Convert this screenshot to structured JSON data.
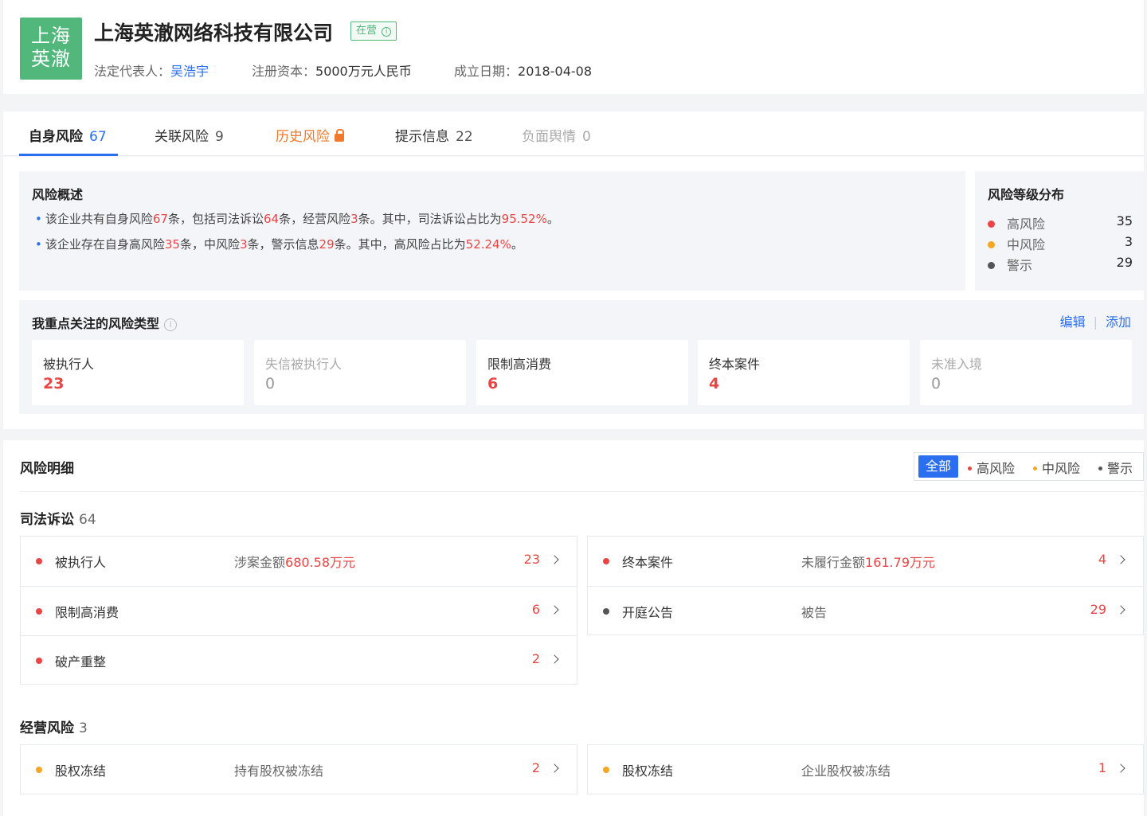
{
  "company": {
    "logo_text_line1": "上海",
    "logo_text_line2": "英澈",
    "name": "上海英澈网络科技有限公司",
    "status": "在营",
    "legal_rep_label": "法定代表人：",
    "legal_rep": "吴浩宇",
    "capital_label": "注册资本：",
    "capital": "5000万元人民币",
    "founded_label": "成立日期：",
    "founded": "2018-04-08"
  },
  "tabs": [
    {
      "label": "自身风险",
      "count": "67"
    },
    {
      "label": "关联风险",
      "count": "9"
    },
    {
      "label": "历史风险",
      "count": ""
    },
    {
      "label": "提示信息",
      "count": "22"
    },
    {
      "label": "负面舆情",
      "count": "0"
    }
  ],
  "overview": {
    "title": "风险概述",
    "line1": {
      "a": "该企业共有自身风险",
      "b": "67",
      "c": "条，包括司法诉讼",
      "d": "64",
      "e": "条，经营风险",
      "f": "3",
      "g": "条。其中，司法诉讼占比为",
      "h": "95.52%",
      "i": "。"
    },
    "line2": {
      "a": "该企业存在自身高风险",
      "b": "35",
      "c": "条，中风险",
      "d": "3",
      "e": "条，警示信息",
      "f": "29",
      "g": "条。其中，高风险占比为",
      "h": "52.24%",
      "i": "。"
    }
  },
  "distribution": {
    "title": "风险等级分布",
    "items": [
      {
        "label": "高风险",
        "value": "35",
        "color": "#e94545"
      },
      {
        "label": "中风险",
        "value": "3",
        "color": "#f5a623"
      },
      {
        "label": "警示",
        "value": "29",
        "color": "#555555"
      }
    ]
  },
  "focus": {
    "title": "我重点关注的风险类型",
    "info_icon": "i",
    "edit": "编辑",
    "add": "添加",
    "cards": [
      {
        "label": "被执行人",
        "value": "23"
      },
      {
        "label": "失信被执行人",
        "value": "0"
      },
      {
        "label": "限制高消费",
        "value": "6"
      },
      {
        "label": "终本案件",
        "value": "4"
      },
      {
        "label": "未准入境",
        "value": "0"
      }
    ]
  },
  "detail": {
    "title": "风险明细",
    "filters": {
      "all": "全部",
      "high": "高风险",
      "mid": "中风险",
      "warn": "警示"
    },
    "judicial": {
      "title": "司法诉讼",
      "count": "64",
      "left": [
        {
          "name": "被执行人",
          "desc_prefix": "涉案金额",
          "desc_value": "680.58万元",
          "count": "23",
          "level_color": "#e94545"
        },
        {
          "name": "限制高消费",
          "desc_prefix": "",
          "desc_value": "",
          "count": "6",
          "level_color": "#e94545"
        },
        {
          "name": "破产重整",
          "desc_prefix": "",
          "desc_value": "",
          "count": "2",
          "level_color": "#e94545"
        }
      ],
      "right": [
        {
          "name": "终本案件",
          "desc_prefix": "未履行金额",
          "desc_value": "161.79万元",
          "count": "4",
          "level_color": "#e94545"
        },
        {
          "name": "开庭公告",
          "desc_prefix": "被告",
          "desc_value": "",
          "count": "29",
          "level_color": "#555555"
        }
      ]
    },
    "operation": {
      "title": "经营风险",
      "count": "3",
      "left": {
        "name": "股权冻结",
        "desc": "持有股权被冻结",
        "count": "2",
        "level_color": "#f5a623"
      },
      "right": {
        "name": "股权冻结",
        "desc": "企业股权被冻结",
        "count": "1",
        "level_color": "#f5a623"
      }
    }
  }
}
